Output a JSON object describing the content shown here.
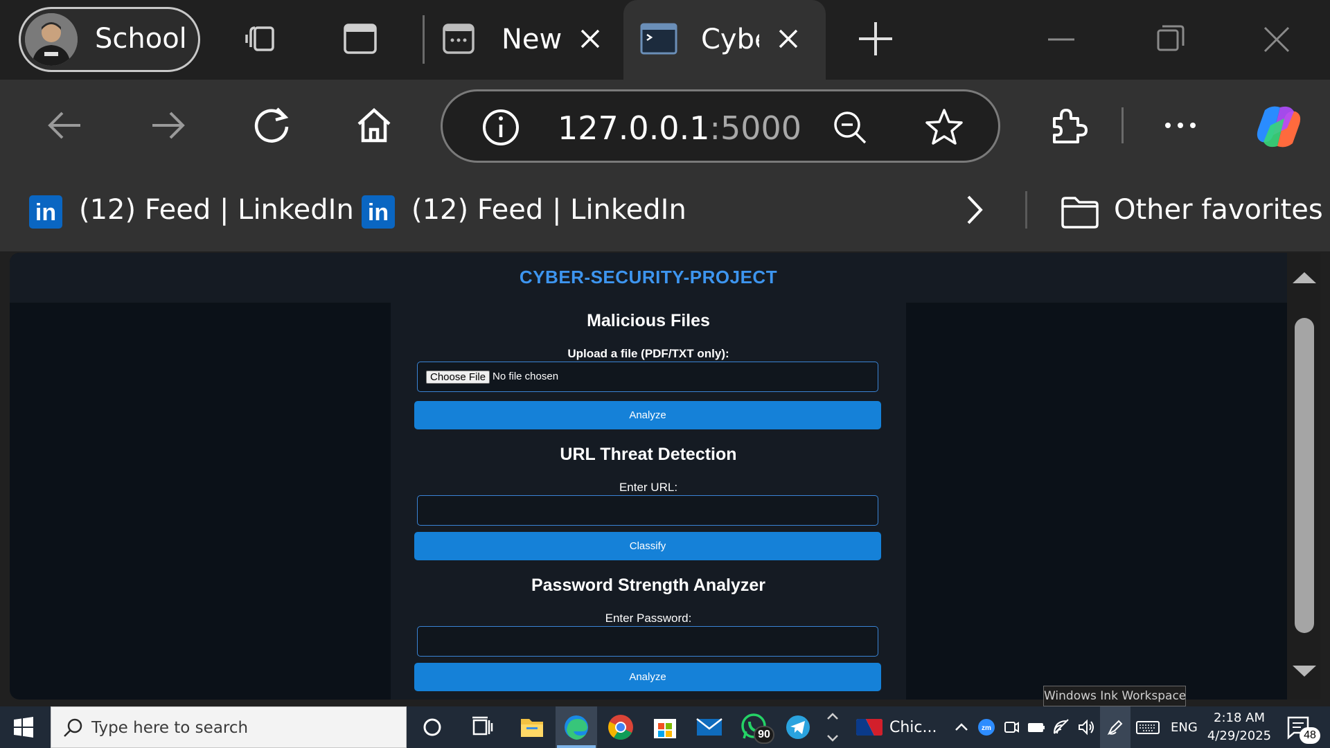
{
  "browser": {
    "profile_label": "School",
    "tabs": [
      {
        "label": "New",
        "active": false
      },
      {
        "label": "Cybe",
        "active": true
      }
    ],
    "address": {
      "host": "127.0.0.1",
      "port": ":5000"
    },
    "favorites": [
      {
        "label": "(12) Feed | LinkedIn",
        "icon": "linkedin-icon"
      },
      {
        "label": "(12) Feed | LinkedIn",
        "icon": "linkedin-icon"
      }
    ],
    "other_favorites_label": "Other favorites"
  },
  "page": {
    "site_title": "CYBER-SECURITY-PROJECT",
    "sections": {
      "malicious_files": {
        "title": "Malicious Files",
        "label": "Upload a file (PDF/TXT only):",
        "choose_button": "Choose File",
        "file_status": "No file chosen",
        "submit": "Analyze"
      },
      "url_threat": {
        "title": "URL Threat Detection",
        "label": "Enter URL:",
        "value": "",
        "submit": "Classify"
      },
      "password": {
        "title": "Password Strength Analyzer",
        "label": "Enter Password:",
        "value": "",
        "submit": "Analyze"
      }
    }
  },
  "tooltip": "Windows Ink Workspace",
  "taskbar": {
    "search_placeholder": "Type here to search",
    "whatsapp_badge": "90",
    "news_label": "Chic...",
    "language": "ENG",
    "time": "2:18 AM",
    "date": "4/29/2025",
    "notification_count": "48"
  },
  "colors": {
    "accent": "#1581d8",
    "site_title": "#3d95ef",
    "page_bg": "#0b1118",
    "panel_bg": "#151b23",
    "browser_chrome": "#323232"
  }
}
